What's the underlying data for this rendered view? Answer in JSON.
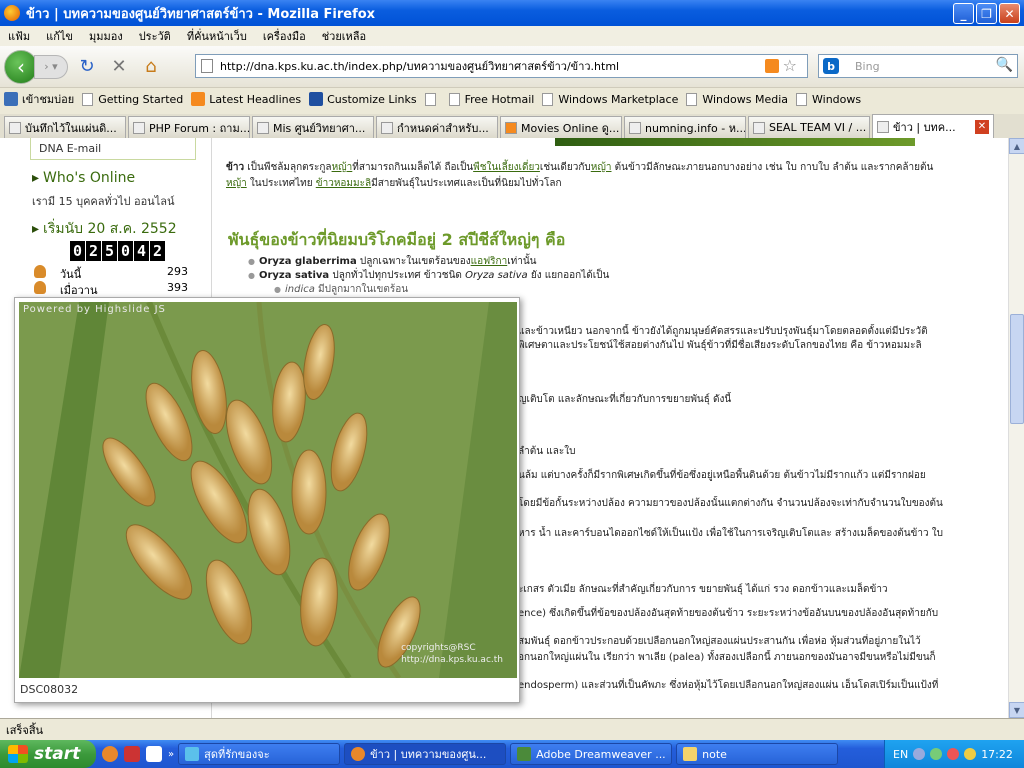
{
  "window": {
    "title": "ข้าว | บทความของศูนย์วิทยาศาสตร์ข้าว - Mozilla Firefox"
  },
  "menu": [
    "แฟ้ม",
    "แก้ไข",
    "มุมมอง",
    "ประวัติ",
    "ที่คั่นหน้าเว็บ",
    "เครื่องมือ",
    "ช่วยเหลือ"
  ],
  "nav": {
    "url": "http://dna.kps.ku.ac.th/index.php/บทความของศูนย์วิทยาศาสตร์ข้าว/ข้าว.html",
    "search_placeholder": "Bing",
    "search_engine": "b"
  },
  "bookmarks": [
    "เข้าชมบ่อย",
    "Getting Started",
    "Latest Headlines",
    "Customize Links",
    "",
    "Free Hotmail",
    "Windows Marketplace",
    "Windows Media",
    "Windows"
  ],
  "tabs": [
    "บันทึกไว้ในแผ่นดิ...",
    "PHP Forum : ถาม...",
    "Mis ศูนย์วิทยาศา...",
    "กำหนดค่าสำหรับ...",
    "Movies Online ดู...",
    "numning.info - ห...",
    "SEAL TEAM VI / ...",
    "ข้าว | บทค..."
  ],
  "sidebar": {
    "dna_email": "DNA E-mail",
    "whos_online_title": "Who's Online",
    "online_text": "เรามี 15 บุคคลทั่วไป ออนไลน์",
    "start_title": "เริ่มนับ 20 ส.ค. 2552",
    "counter": [
      "0",
      "2",
      "5",
      "0",
      "4",
      "2"
    ],
    "stats": [
      {
        "label": "วันนี้",
        "value": "293"
      },
      {
        "label": "เมื่อวาน",
        "value": "393"
      }
    ]
  },
  "content": {
    "intro_1": "ข้าว",
    "intro_2": " เป็นพืชล้มลุกตระกูล",
    "intro_link1": "หญ้า",
    "intro_3": "ที่สามารถกินเมล็ดได้ ถือเป็น",
    "intro_link2": "พืชในเลี้ยงเดี่ยว",
    "intro_4": "เช่นเดียวกับ",
    "intro_link3": "หญ้า",
    "intro_5": " ต้นข้าวมีลักษณะภายนอกบางอย่าง เช่น ใบ กาบใบ ลำต้น และรากคล้ายต้น",
    "intro_link4": "หญ้า",
    "intro_6": " ในประเทศไทย ",
    "intro_link5": "ข้าวหอมมะลิ",
    "intro_7": "มีสายพันธุ์ในประเทศและเป็นที่นิยมไปทั่วโลก",
    "heading": "พันธุ์ของข้าวที่นิยมบริโภคมีอยู่ 2 สปีชีส์ใหญ่ๆ คือ",
    "bullet1_b": "Oryza glaberrima",
    "bullet1_t": " ปลูกเฉพาะในเขตร้อนของ",
    "bullet1_link": "แอฟริกา",
    "bullet1_t2": "เท่านั้น",
    "bullet2_b": "Oryza sativa",
    "bullet2_t": " ปลูกทั่วไปทุกประเทศ ข้าวชนิด ",
    "bullet2_i": "Oryza sativa",
    "bullet2_t2": " ยัง แยกออกได้เป็น",
    "sub1_i": "indica",
    "sub1_t": " มีปลูกมากในเขตร้อน",
    "lines": [
      "และข้าวเหนียว นอกจากนี้ ข้าวยังได้ถูกมนุษย์คัดสรรและปรับปรุงพันธุ์มาโดยตลอดตั้งแต่มีประวัติ",
      "พิเศษตาและประโยชน์ใช้สอยต่างกันไป พันธุ์ข้าวที่มีชื่อเสียงระดับโลกของไทย คือ ข้าวหอมมะลิ",
      "ญเติบโต และลักษณะที่เกี่ยวกับการขยายพันธุ์ ดังนี้",
      "ลำต้น และใบ",
      "ินล้ม แต่บางครั้งก็มีรากพิเศษเกิดขึ้นที่ข้อซึ่งอยู่เหนือพื้นดินด้วย ต้นข้าวไม่มีรากแก้ว แต่มีรากฝอย",
      "โดยมีข้อกั้นระหว่างปล้อง ความยาวของปล้องนั้นแตกต่างกัน จำนวนปล้องจะเท่ากับจำนวนใบของต้น",
      "หาร น้ำ และคาร์บอนไดออกไซด์ให้เป็นแป้ง เพื่อใช้ในการเจริญเติบโตและ สร้างเมล็ดของต้นข้าว ใบ",
      "ะเกสร ตัวเมีย ลักษณะที่สำคัญเกี่ยวกับการ ขยายพันธุ์ ได้แก่ รวง ดอกข้าวและเมล็ดข้าว",
      "ence) ซึ่งเกิดขึ้นที่ข้อของปล้องอันสุดท้ายของต้นข้าว ระยะระหว่างข้ออันบนของปล้องอันสุดท้ายกับ",
      "สมพันธุ์ ดอกข้าวประกอบด้วยเปลือกนอกใหญ่สองแผ่นประสานกัน เพื่อห่อ หุ้มส่วนที่อยู่ภายในไว้",
      "อกนอกใหญ่แผ่นใน เรียกว่า พาเลีย (palea) ทั้งสองเปลือกนี้ ภายนอกของมันอาจมีขนหรือไม่มีขนก็",
      "endosperm) และส่วนที่เป็นคัพภะ ซึ่งห่อหุ้มไว้โดยเปลือกนอกใหญ่สองแผ่น เอ็นโดสเปิร์มเป็นแป้งที่"
    ]
  },
  "popup": {
    "powered": "Powered by Highslide JS",
    "copyright_1": "copyrights@RSC",
    "copyright_2": "http://dna.kps.ku.ac.th",
    "caption": "DSC08032"
  },
  "status": "เสร็จสิ้น",
  "taskbar": {
    "start": "start",
    "tasks": [
      "สุดที่รักของจะ",
      "ข้าว | บทความของศูน...",
      "Adobe Dreamweaver ...",
      "note"
    ],
    "lang": "EN",
    "time": "17:22"
  }
}
